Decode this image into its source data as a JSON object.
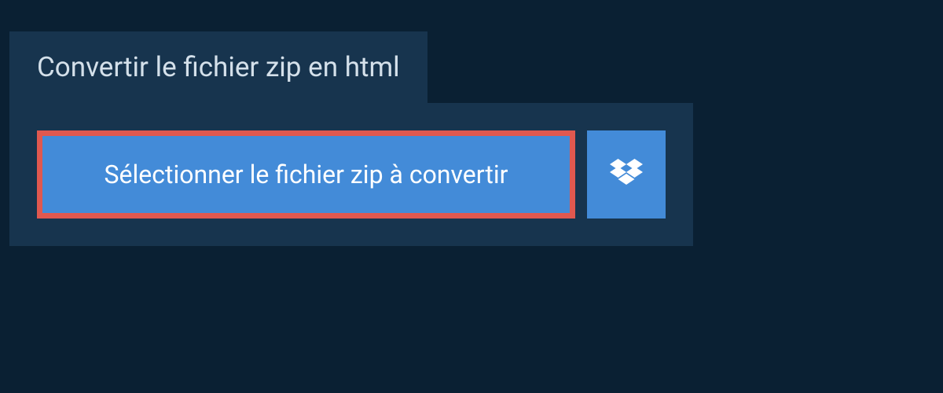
{
  "header": {
    "title": "Convertir le fichier zip en html"
  },
  "panel": {
    "selectButton": {
      "label": "Sélectionner le fichier zip à convertir"
    }
  },
  "colors": {
    "background": "#0a2033",
    "panel": "#17344e",
    "buttonBg": "#438bd8",
    "buttonBorder": "#e0584f",
    "textLight": "#d4e0ea",
    "textWhite": "#ffffff"
  }
}
